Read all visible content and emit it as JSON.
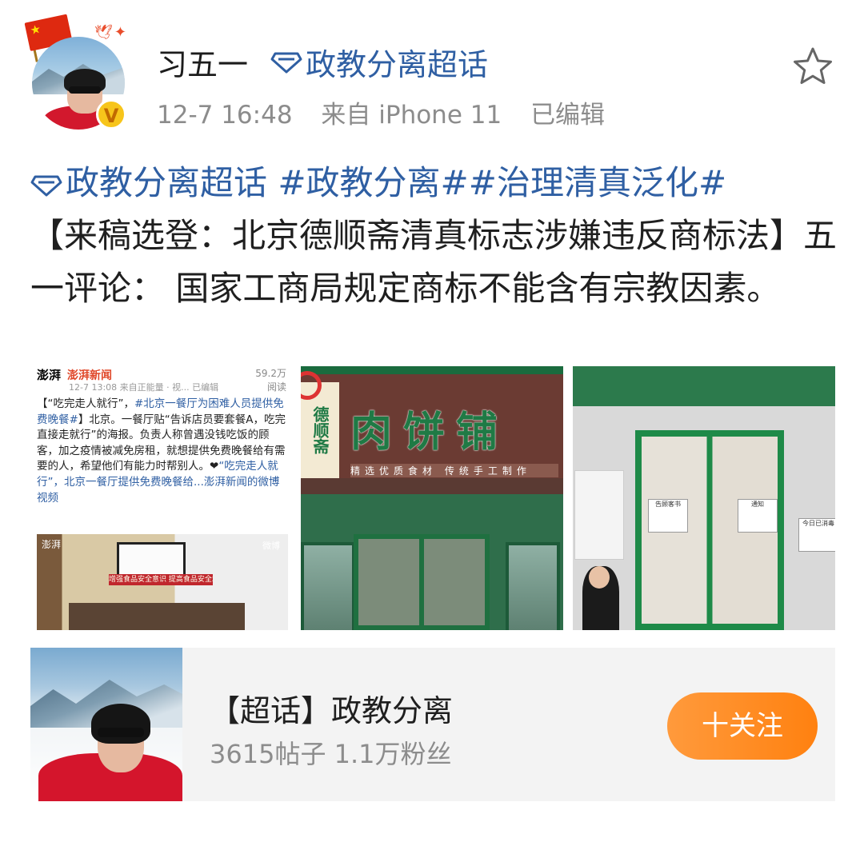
{
  "post": {
    "author": "习五一",
    "super_topic_head": "政教分离超话",
    "time": "12-7 16:48",
    "source": "来自 iPhone 11",
    "edited": "已编辑",
    "verified_badge": "V",
    "tags_line": [
      "政教分离超话",
      " #政教分离##治理清真泛化#"
    ],
    "body_text": "【来稿选登：北京德顺斋清真标志涉嫌违反商标法】五一评论： 国家工商局规定商标不能含有宗教因素。"
  },
  "images": {
    "news": {
      "logo": "澎湃",
      "name": "澎湃新闻",
      "count": "59.2万",
      "count_sub": "阅读",
      "sub": "12-7 13:08  来自正能量 · 视...  已编辑",
      "body_a": "【“吃完走人就行”，",
      "body_b": "#北京一餐厅为困难人员提供免费晚餐#",
      "body_c": "】北京。一餐厅贴“告诉店员要套餐A，吃完直接走就行”的海报。负责人称曾遇没钱吃饭的顾客，加之疫情被减免房租，就想提供免费晚餐给有需要的人，希望他们有能力时帮别人。❤",
      "body_d": "“吃完走人就行”，北京一餐厅提供免费晚餐给...",
      "body_e": "澎湃新闻的微博视频",
      "photo_mark": "澎湃",
      "photo_mark2": "微博",
      "photo_banner": "增强食品安全意识 提高食品安全水平"
    },
    "sign": {
      "left": "德顺斋",
      "main": "肉饼铺",
      "sub": "精选优质食材  传统手工制作"
    },
    "doors": {
      "notice1": "告顾客书",
      "notice2": "通知",
      "notice3": "今日已消毒"
    }
  },
  "card": {
    "title": "【超话】政教分离",
    "stats": "3615帖子 1.1万粉丝",
    "follow": "十关注"
  },
  "colors": {
    "link": "#2f5fa3",
    "meta": "#8c8c8c",
    "follow_button": "#ff8a1f",
    "card_bg": "#f3f3f3"
  },
  "icons": [
    "china-flag-icon",
    "verified-v-icon",
    "super-topic-diamond-icon",
    "star-icon"
  ]
}
